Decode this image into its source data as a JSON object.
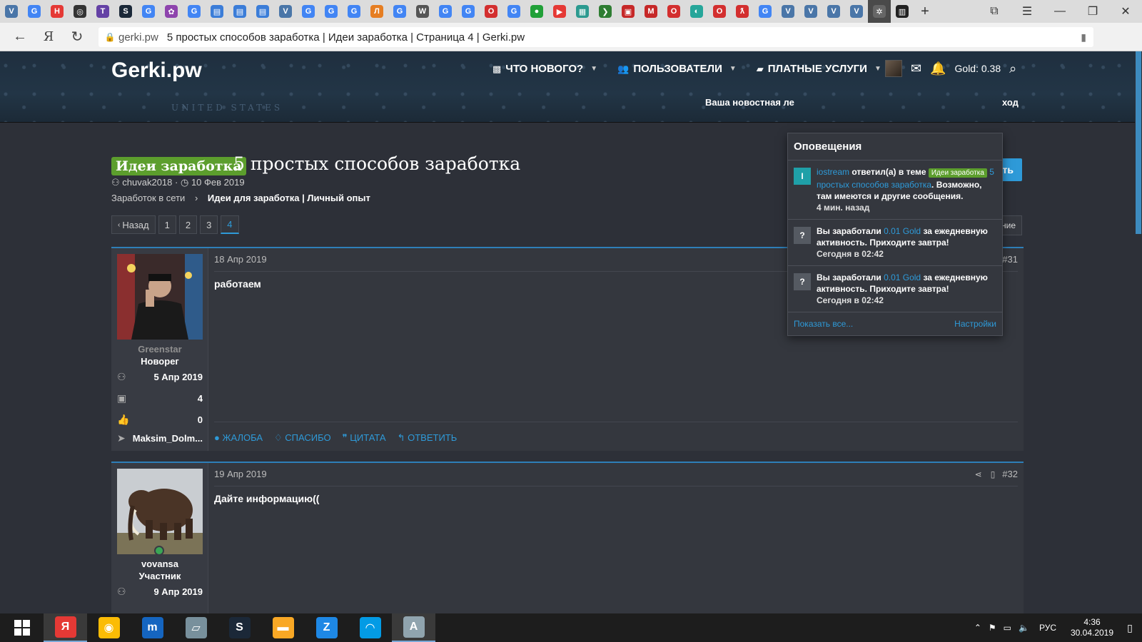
{
  "browser": {
    "tab_icons": [
      {
        "name": "vk-icon",
        "glyph": "V",
        "color": "#4a76a8"
      },
      {
        "name": "google-icon",
        "glyph": "G",
        "color": "#4285f4"
      },
      {
        "name": "habr-icon",
        "glyph": "H",
        "color": "#e53935"
      },
      {
        "name": "instagram-icon",
        "glyph": "◎",
        "color": "#333333"
      },
      {
        "name": "twitch-icon",
        "glyph": "T",
        "color": "#6441a5"
      },
      {
        "name": "steam-icon",
        "glyph": "S",
        "color": "#1b2838"
      },
      {
        "name": "google-icon",
        "glyph": "G",
        "color": "#4285f4"
      },
      {
        "name": "apps-icon",
        "glyph": "✿",
        "color": "#8e44ad"
      },
      {
        "name": "google-icon",
        "glyph": "G",
        "color": "#4285f4"
      },
      {
        "name": "chat-icon",
        "glyph": "▤",
        "color": "#3b7dd8"
      },
      {
        "name": "chat-icon",
        "glyph": "▤",
        "color": "#3b7dd8"
      },
      {
        "name": "chat-icon",
        "glyph": "▤",
        "color": "#3b7dd8"
      },
      {
        "name": "vk-icon",
        "glyph": "V",
        "color": "#4a76a8"
      },
      {
        "name": "google-icon",
        "glyph": "G",
        "color": "#4285f4"
      },
      {
        "name": "google-icon",
        "glyph": "G",
        "color": "#4285f4"
      },
      {
        "name": "google-icon",
        "glyph": "G",
        "color": "#4285f4"
      },
      {
        "name": "letter-l-icon",
        "glyph": "Л",
        "color": "#e67e22"
      },
      {
        "name": "google-icon",
        "glyph": "G",
        "color": "#4285f4"
      },
      {
        "name": "wikipedia-icon",
        "glyph": "W",
        "color": "#555555"
      },
      {
        "name": "google-icon",
        "glyph": "G",
        "color": "#4285f4"
      },
      {
        "name": "google-icon",
        "glyph": "G",
        "color": "#4285f4"
      },
      {
        "name": "opera-icon",
        "glyph": "O",
        "color": "#d32f2f"
      },
      {
        "name": "google-icon",
        "glyph": "G",
        "color": "#4285f4"
      },
      {
        "name": "sberbank-icon",
        "glyph": "●",
        "color": "#21a038"
      },
      {
        "name": "youtube-icon",
        "glyph": "▶",
        "color": "#e53935"
      },
      {
        "name": "bank-icon",
        "glyph": "▦",
        "color": "#2b9a8f"
      },
      {
        "name": "arrow-icon",
        "glyph": "❯",
        "color": "#2e7d32"
      },
      {
        "name": "bus-icon",
        "glyph": "▣",
        "color": "#c62828"
      },
      {
        "name": "mp-icon",
        "glyph": "M",
        "color": "#c62828"
      },
      {
        "name": "opera-icon",
        "glyph": "O",
        "color": "#d32f2f"
      },
      {
        "name": "compass-icon",
        "glyph": "◐",
        "color": "#26a69a"
      },
      {
        "name": "opera-icon",
        "glyph": "O",
        "color": "#d32f2f"
      },
      {
        "name": "lastfm-icon",
        "glyph": "ƛ",
        "color": "#d32f2f"
      },
      {
        "name": "google-icon",
        "glyph": "G",
        "color": "#4285f4"
      },
      {
        "name": "vk-icon",
        "glyph": "V",
        "color": "#4a76a8"
      },
      {
        "name": "vk-icon",
        "glyph": "V",
        "color": "#4a76a8"
      },
      {
        "name": "vk-icon",
        "glyph": "V",
        "color": "#4a76a8"
      },
      {
        "name": "vk-icon",
        "glyph": "V",
        "color": "#4a76a8"
      },
      {
        "name": "site-icon",
        "glyph": "✲",
        "color": "#666666"
      },
      {
        "name": "site-icon",
        "glyph": "▥",
        "color": "#222222"
      }
    ],
    "new_tab_glyph": "+",
    "url_host": "gerki.pw",
    "page_title": "5 простых способов заработка | Идеи заработка | Страница 4 | Gerki.pw"
  },
  "header": {
    "logo": "Gerki.pw",
    "nav": [
      {
        "label": "ЧТО НОВОГО?",
        "icon": "chat-bubble-icon"
      },
      {
        "label": "ПОЛЬЗОВАТЕЛИ",
        "icon": "users-icon"
      },
      {
        "label": "ПЛАТНЫЕ УСЛУГИ",
        "icon": "folder-icon"
      }
    ],
    "gold": "Gold: 0.38",
    "tagline_left": "Ваша новостная ле",
    "tagline_right": "ход",
    "map_label": "UNITED STATES"
  },
  "thread": {
    "prefix": "Идеи заработка",
    "title": "5 простых способов заработка",
    "author": "chuvak2018",
    "date": "10 Фев 2019",
    "crumb1": "Заработок в сети",
    "crumb2": "Идеи для заработка | Личный опыт",
    "reply_label": "ить",
    "watch_label": "ние",
    "pager": {
      "prev": "Назад",
      "pages": [
        "1",
        "2",
        "3",
        "4"
      ],
      "current": "4"
    }
  },
  "posts": [
    {
      "date": "18 Апр 2019",
      "number": "#31",
      "username": "Greenstar",
      "username_color": "#8f8f8f",
      "role": "Новорег",
      "joined": "5 Апр 2019",
      "messages": "4",
      "reactions": "0",
      "telegram": "Maksim_Dolm...",
      "body": "работаем",
      "report": "ЖАЛОБА",
      "like": "СПАСИБО",
      "quote": "ЦИТАТА",
      "reply": "ОТВЕТИТЬ"
    },
    {
      "date": "19 Апр 2019",
      "number": "#32",
      "username": "vovansa",
      "username_color": "#ffffff",
      "role": "Участник",
      "joined": "9 Апр 2019",
      "body": "Дайте информацию(("
    }
  ],
  "notifications": {
    "title": "Оповещения",
    "items": [
      {
        "avatar": "I",
        "avatar_color": "#1fa0a8",
        "user": "iostream",
        "text1": " ответил(а) в теме ",
        "prefix": "Идеи заработка",
        "thread": "5 простых способов заработка",
        "text2": ". Возможно, там имеются и другие сообщения.",
        "time": "4 мин. назад"
      },
      {
        "avatar": "?",
        "avatar_color": "#555a62",
        "text1": "Вы заработали ",
        "amount": "0.01 Gold",
        "text2": " за ежедневную активность. Приходите завтра!",
        "time": "Сегодня в 02:42"
      },
      {
        "avatar": "?",
        "avatar_color": "#555a62",
        "text1": "Вы заработали ",
        "amount": "0.01 Gold",
        "text2": " за ежедневную активность. Приходите завтра!",
        "time": "Сегодня в 02:42"
      }
    ],
    "show_all": "Показать все...",
    "settings": "Настройки"
  },
  "taskbar": {
    "apps": [
      {
        "name": "yandex-browser-icon",
        "glyph": "Я",
        "color": "#e53935",
        "open": true
      },
      {
        "name": "chrome-icon",
        "glyph": "◉",
        "color": "#fbbc05",
        "open": false
      },
      {
        "name": "maxthon-icon",
        "glyph": "m",
        "color": "#1565c0",
        "open": false
      },
      {
        "name": "notes-icon",
        "glyph": "▱",
        "color": "#78909c",
        "open": false
      },
      {
        "name": "steam-icon",
        "glyph": "S",
        "color": "#1b2838",
        "open": false
      },
      {
        "name": "explorer-icon",
        "glyph": "▬",
        "color": "#f9a825",
        "open": false
      },
      {
        "name": "app-z-icon",
        "glyph": "Z",
        "color": "#1e88e5",
        "open": false
      },
      {
        "name": "wifi-app-icon",
        "glyph": "◠",
        "color": "#039be5",
        "open": false
      },
      {
        "name": "editor-icon",
        "glyph": "A",
        "color": "#90a4ae",
        "open": true
      }
    ],
    "lang": "РУС",
    "time": "4:36",
    "date": "30.04.2019"
  }
}
